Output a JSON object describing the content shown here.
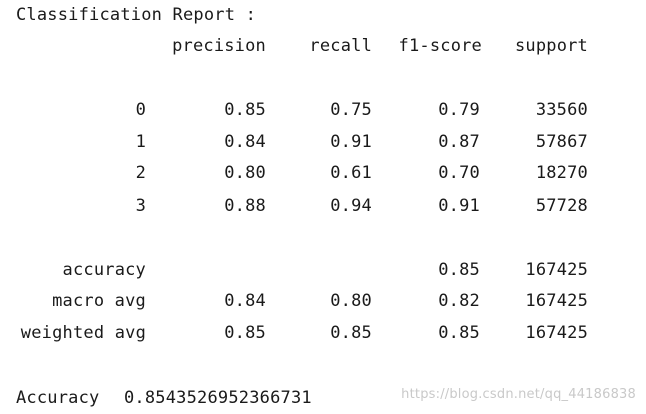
{
  "report_title": "Classification Report :",
  "headers": [
    "precision",
    "recall",
    "f1-score",
    "support"
  ],
  "rows": [
    {
      "label": "0",
      "precision": "0.85",
      "recall": "0.75",
      "f1": "0.79",
      "support": "33560"
    },
    {
      "label": "1",
      "precision": "0.84",
      "recall": "0.91",
      "f1": "0.87",
      "support": "57867"
    },
    {
      "label": "2",
      "precision": "0.80",
      "recall": "0.61",
      "f1": "0.70",
      "support": "18270"
    },
    {
      "label": "3",
      "precision": "0.88",
      "recall": "0.94",
      "f1": "0.91",
      "support": "57728"
    }
  ],
  "summary": [
    {
      "label": "accuracy",
      "precision": "",
      "recall": "",
      "f1": "0.85",
      "support": "167425"
    },
    {
      "label": "macro avg",
      "precision": "0.84",
      "recall": "0.80",
      "f1": "0.82",
      "support": "167425"
    },
    {
      "label": "weighted avg",
      "precision": "0.85",
      "recall": "0.85",
      "f1": "0.85",
      "support": "167425"
    }
  ],
  "accuracy_line": {
    "label": "Accuracy",
    "value": "0.8543526952366731"
  },
  "watermark": "https://blog.csdn.net/qq_44186838"
}
